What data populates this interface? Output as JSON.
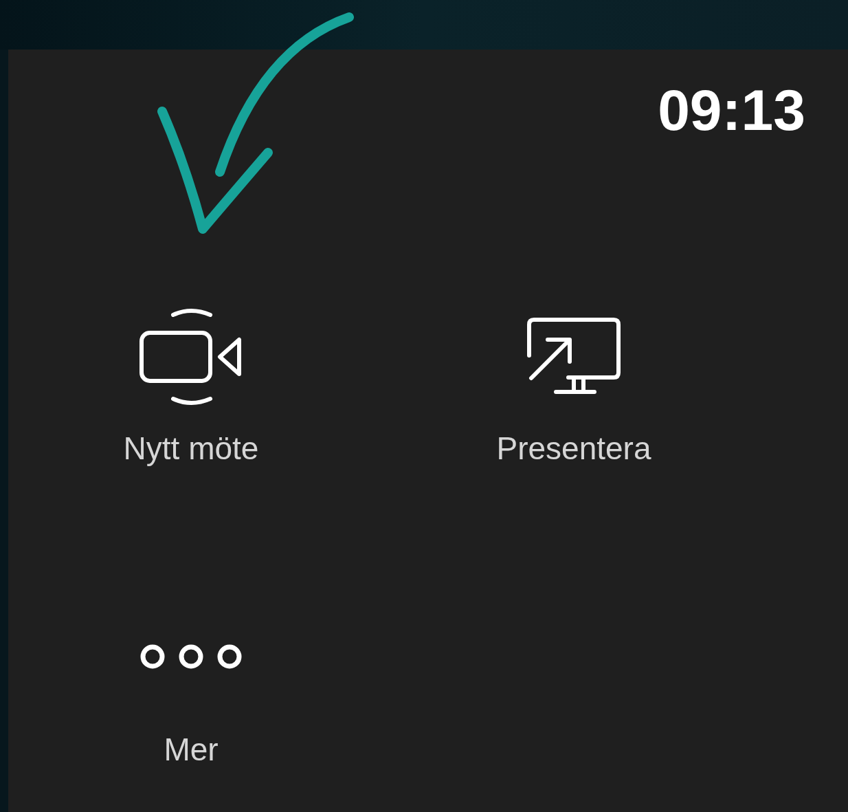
{
  "clock": "09:13",
  "actions": [
    {
      "kind": "video",
      "label": "Nytt möte"
    },
    {
      "kind": "share",
      "label": "Presentera"
    },
    {
      "kind": "more",
      "label": "Mer"
    }
  ]
}
